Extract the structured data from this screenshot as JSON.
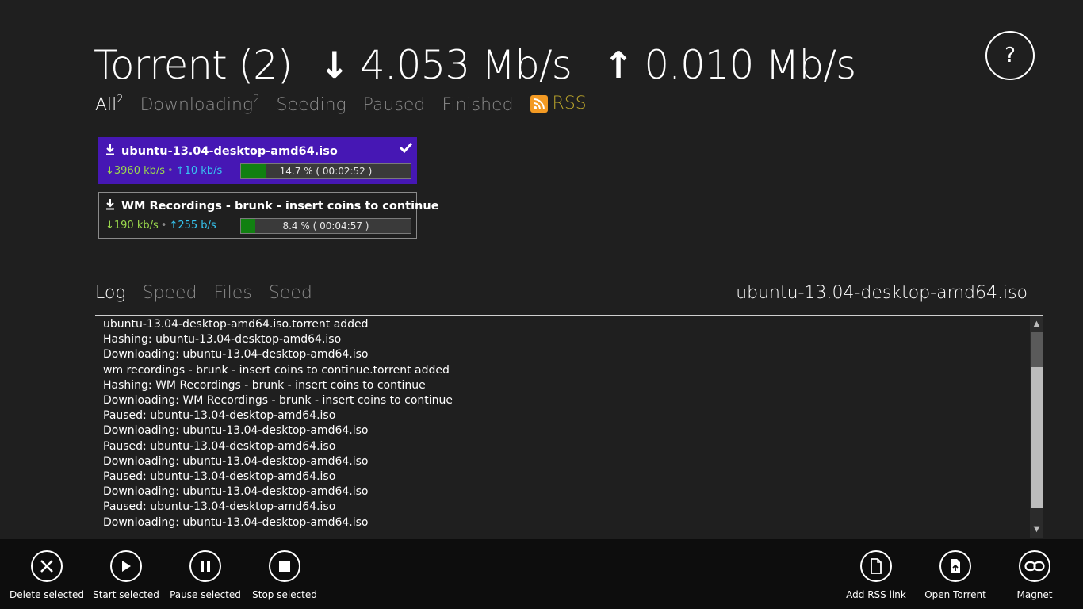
{
  "header": {
    "title": "Torrent (2)",
    "download_rate": "4.053 Mb/s",
    "upload_rate": "0.010 Mb/s",
    "down_arrow": "↓",
    "up_arrow": "↑",
    "help_label": "?"
  },
  "filters": [
    {
      "label": "All",
      "count": "2"
    },
    {
      "label": "Downloading",
      "count": "2"
    },
    {
      "label": "Seeding"
    },
    {
      "label": "Paused"
    },
    {
      "label": "Finished"
    }
  ],
  "rss_label": "RSS",
  "torrents": [
    {
      "name": "ubuntu-13.04-desktop-amd64.iso",
      "down": "↓3960 kb/s",
      "up": "↑10 kb/s",
      "progress_label": "14.7 % ( 00:02:52 )",
      "progress_fraction": 0.147,
      "selected": true
    },
    {
      "name": "WM Recordings - brunk - insert coins to continue",
      "down": "↓190 kb/s",
      "up": "↑255 b/s",
      "progress_label": "8.4 % ( 00:04:57 )",
      "progress_fraction": 0.084,
      "selected": false
    }
  ],
  "tabs": [
    "Log",
    "Speed",
    "Files",
    "Seed"
  ],
  "selected_torrent_name": "ubuntu-13.04-desktop-amd64.iso",
  "log": [
    "ubuntu-13.04-desktop-amd64.iso.torrent added",
    "Hashing: ubuntu-13.04-desktop-amd64.iso",
    "Downloading: ubuntu-13.04-desktop-amd64.iso",
    "wm recordings - brunk - insert coins to continue.torrent added",
    "Hashing: WM Recordings - brunk - insert coins to continue",
    "Downloading: WM Recordings - brunk - insert coins to continue",
    "Paused: ubuntu-13.04-desktop-amd64.iso",
    "Downloading: ubuntu-13.04-desktop-amd64.iso",
    "Paused: ubuntu-13.04-desktop-amd64.iso",
    "Downloading: ubuntu-13.04-desktop-amd64.iso",
    "Paused: ubuntu-13.04-desktop-amd64.iso",
    "Downloading: ubuntu-13.04-desktop-amd64.iso",
    "Paused: ubuntu-13.04-desktop-amd64.iso",
    "Downloading: ubuntu-13.04-desktop-amd64.iso"
  ],
  "appbar": {
    "delete": "Delete selected",
    "start": "Start selected",
    "pause": "Pause selected",
    "stop": "Stop selected",
    "add_rss": "Add RSS link",
    "open_torrent": "Open Torrent",
    "magnet": "Magnet"
  },
  "colors": {
    "background": "#1f1f1f",
    "selected_item": "#4617b4",
    "progress_fill": "#118011",
    "download_text": "#9bd94d",
    "upload_text": "#36c6f2",
    "rss": "#b9a32b",
    "appbar": "#0d0d0d"
  }
}
